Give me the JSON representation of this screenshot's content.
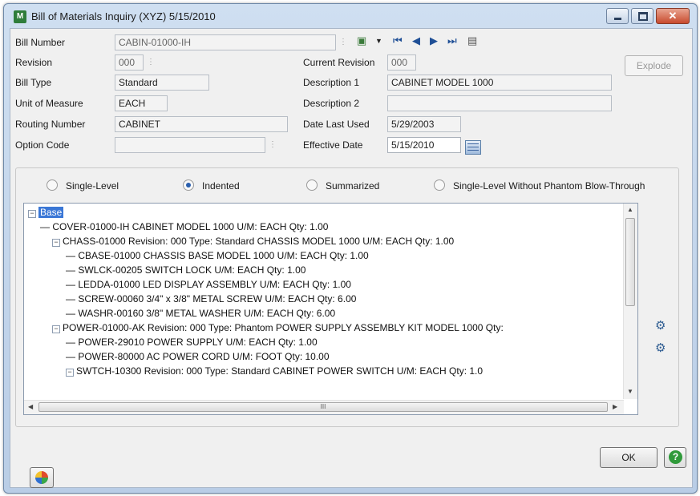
{
  "window": {
    "title": "Bill of Materials Inquiry (XYZ) 5/15/2010",
    "close_glyph": "✕"
  },
  "form": {
    "bill_number_label": "Bill Number",
    "bill_number_value": "CABIN-01000-IH",
    "revision_label": "Revision",
    "revision_value": "000",
    "current_revision_label": "Current Revision",
    "current_revision_value": "000",
    "bill_type_label": "Bill Type",
    "bill_type_value": "Standard",
    "description1_label": "Description 1",
    "description1_value": "CABINET MODEL 1000",
    "uom_label": "Unit of Measure",
    "uom_value": "EACH",
    "description2_label": "Description 2",
    "description2_value": "",
    "routing_label": "Routing Number",
    "routing_value": "CABINET",
    "date_last_used_label": "Date Last Used",
    "date_last_used_value": "5/29/2003",
    "option_code_label": "Option Code",
    "option_code_value": "",
    "effective_date_label": "Effective Date",
    "effective_date_value": "5/15/2010",
    "explode_label": "Explode"
  },
  "nav_icons": [
    "first-record-icon",
    "previous-record-icon",
    "next-record-icon",
    "last-record-icon",
    "list-icon"
  ],
  "view_options": {
    "single_level": "Single-Level",
    "indented": "Indented",
    "summarized": "Summarized",
    "single_level_no_phantom": "Single-Level Without Phantom Blow-Through",
    "selected": "Indented"
  },
  "tree": {
    "rows": [
      {
        "text": "Base"
      },
      {
        "text": "COVER-01000-IH    CABINET MODEL 1000    U/M: EACH    Qty: 1.00"
      },
      {
        "text": "CHASS-01000    Revision: 000    Type: Standard    CHASSIS MODEL 1000      U/M: EACH      Qty: 1.00"
      },
      {
        "text": "CBASE-01000    CHASSIS BASE MODEL 1000    U/M: EACH    Qty: 1.00"
      },
      {
        "text": "SWLCK-00205    SWITCH LOCK    U/M: EACH    Qty: 1.00"
      },
      {
        "text": "LEDDA-01000    LED DISPLAY ASSEMBLY    U/M: EACH    Qty: 1.00"
      },
      {
        "text": "SCREW-00060    3/4\" x 3/8\" METAL SCREW    U/M: EACH    Qty: 6.00"
      },
      {
        "text": "WASHR-00160    3/8\" METAL WASHER    U/M: EACH    Qty: 6.00"
      },
      {
        "text": "POWER-01000-AK    Revision: 000    Type: Phantom    POWER SUPPLY ASSEMBLY KIT MODEL 1000    Qty:"
      },
      {
        "text": "POWER-29010    POWER SUPPLY    U/M: EACH    Qty: 1.00"
      },
      {
        "text": "POWER-80000    AC POWER CORD    U/M: FOOT    Qty: 10.00"
      },
      {
        "text": "SWTCH-10300    Revision: 000    Type: Standard    CABINET POWER SWITCH      U/M: EACH      Qty: 1.0"
      }
    ],
    "hscroll_grip": "III"
  },
  "buttons": {
    "ok": "OK",
    "help": "?"
  }
}
